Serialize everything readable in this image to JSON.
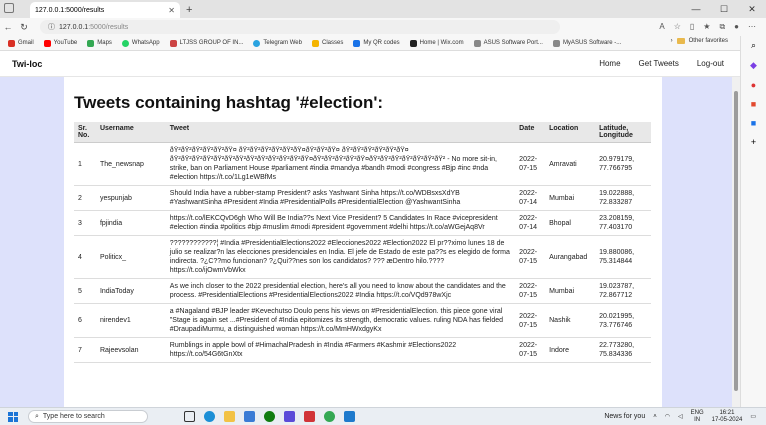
{
  "browser": {
    "tab_title": "127.0.0.1:5000/results",
    "url_prefix": "127.0.0.1",
    "url_rest": ":5000/results",
    "bookmarks": [
      "Gmail",
      "YouTube",
      "Maps",
      "WhatsApp",
      "LTJSS GROUP OF IN...",
      "Telegram Web",
      "Classes",
      "My QR codes",
      "Home | Wix.com",
      "ASUS Software Port...",
      "MyASUS Software -..."
    ],
    "other_favorites": "Other favorites"
  },
  "app": {
    "brand": "Twi-loc",
    "nav": [
      "Home",
      "Get Tweets",
      "Log-out"
    ]
  },
  "page": {
    "title": "Tweets containing hashtag '#election':",
    "columns": [
      "Sr. No.",
      "Username",
      "Tweet",
      "Date",
      "Location",
      "Latitude, Longitude"
    ],
    "rows": [
      {
        "sr": "1",
        "username": "The_newsnap",
        "tweet": "ðŸ²ðŸ²ðŸ²ðŸ²ðŸ²ðŸ¤ ðŸ²ðŸ²ðŸ²ðŸ²ðŸ²ðŸ¤ðŸ²ðŸ²ðŸ¤ ðŸ²ðŸ²ðŸ²ðŸ²ðŸ²ðŸ¤ ðŸ²ðŸ²ðŸ²ðŸ²ðŸ²ðŸ²ðŸ²ðŸ²ðŸ²ðŸ²ðŸ²ðŸ²ðŸ¤ðŸ²ðŸ²ðŸ²ðŸ²ðŸ¤ðŸ²ðŸ²ðŸ²ðŸ²ðŸ²ðŸ²ðŸ² - No more sit-in, strike, ban on Parliament House #parliament #india #mandya #bandh #modi #congress #Bjp #inc #nda #election https://t.co/1Lg1eWBfMs",
        "date": "2022-07-15",
        "location": "Amravati",
        "latlng": "20.979179, 77.766795"
      },
      {
        "sr": "2",
        "username": "yespunjab",
        "tweet": "Should India have a rubber-stamp President? asks Yashwant Sinha https://t.co/WDBsxsXdYB #YashwantSinha #President #India #PresidentialPolls #PresidentialElection @YashwantSinha",
        "date": "2022-07-14",
        "location": "Mumbai",
        "latlng": "19.022888, 72.833287"
      },
      {
        "sr": "3",
        "username": "fpjindia",
        "tweet": "https://t.co/lEKCQvD6gh Who Will Be India??s Next Vice President? 5 Candidates In Race #vicepresident #election #india #politics #bjp #muslim #modi #president #government #delhi https://t.co/aWGejAq8Vr",
        "date": "2022-07-14",
        "location": "Bhopal",
        "latlng": "23.208159, 77.403170"
      },
      {
        "sr": "4",
        "username": "Politicx_",
        "tweet": "????????????¦ #India #PresidentialElections2022 #Elecciones2022 #Election2022 El pr??ximo lunes 18 de julio se realizar?n las elecciones presidenciales en India. El jefe de Estado de este pa??s es elegido de forma indirecta. ?¿C??mo funcionan? ?¿Qui??nes son los candidatos? ??? æDentro hilo.???? https://t.co/ijOwmVbWkx",
        "date": "2022-07-15",
        "location": "Aurangabad",
        "latlng": "19.880086, 75.314844"
      },
      {
        "sr": "5",
        "username": "IndiaToday",
        "tweet": "As we inch closer to the 2022 presidential election, here's all you need to know about the candidates and the process. #PresidentialElections #PresidentialElections2022 #India https://t.co/VQd978wXjc",
        "date": "2022-07-15",
        "location": "Mumbai",
        "latlng": "19.023787, 72.867712"
      },
      {
        "sr": "6",
        "username": "nirendev1",
        "tweet": "a #Nagaland #BJP leader #Kevechutso Doulo pens his views on #PresidentialElection. this piece gone viral \"Stage is again set ...#President of #India epitomizes its strength, democratic values. ruling NDA has fielded #DraupadiMurmu, a distinguished woman https://t.co/MmHWxdgyKx",
        "date": "2022-07-15",
        "location": "Nashik",
        "latlng": "20.021995, 73.776746"
      },
      {
        "sr": "7",
        "username": "Rajeevsolan",
        "tweet": "Rumblings in apple bowl of #HimachalPradesh in #India #Farmers #Kashmir #Elections2022 https://t.co/54G6tGnXtx",
        "date": "2022-07-15",
        "location": "Indore",
        "latlng": "22.773280, 75.834336"
      }
    ]
  },
  "taskbar": {
    "search_placeholder": "Type here to search",
    "news": "News for you",
    "lang": "ENG",
    "region": "IN",
    "time": "16:21",
    "date": "17-05-2024"
  }
}
